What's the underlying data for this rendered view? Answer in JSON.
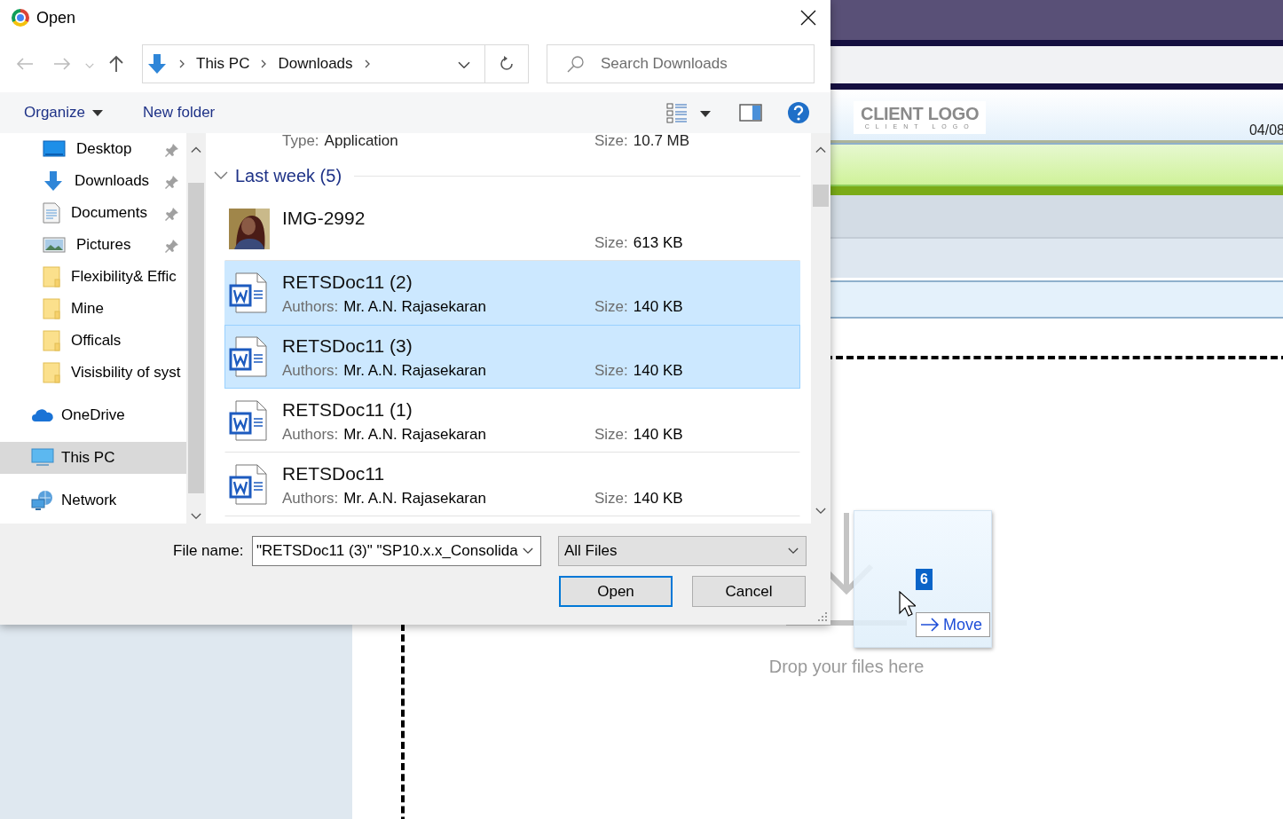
{
  "dialog": {
    "title": "Open",
    "breadcrumb": [
      "This PC",
      "Downloads"
    ],
    "search": {
      "placeholder": "Search Downloads"
    },
    "toolbar": {
      "organize": "Organize",
      "new_folder": "New folder"
    },
    "quick_access": [
      {
        "label": "Desktop",
        "kind": "desktop",
        "pinned": true,
        "selected": false
      },
      {
        "label": "Downloads",
        "kind": "download",
        "pinned": true,
        "selected": false
      },
      {
        "label": "Documents",
        "kind": "documents",
        "pinned": true,
        "selected": false
      },
      {
        "label": "Pictures",
        "kind": "pictures",
        "pinned": true,
        "selected": false
      },
      {
        "label": "Flexibility& Effic",
        "kind": "folder",
        "pinned": false,
        "selected": false
      },
      {
        "label": "Mine",
        "kind": "folder",
        "pinned": false,
        "selected": false
      },
      {
        "label": "Officals",
        "kind": "folder",
        "pinned": false,
        "selected": false
      },
      {
        "label": "Visisbility of syst",
        "kind": "folder",
        "pinned": false,
        "selected": false
      }
    ],
    "locations": [
      {
        "label": "OneDrive",
        "kind": "cloud",
        "selected": false
      },
      {
        "label": "This PC",
        "kind": "pc",
        "selected": true
      },
      {
        "label": "Network",
        "kind": "network",
        "selected": false
      }
    ],
    "partial_item": {
      "type_label": "Type:",
      "type": "Application",
      "size_label": "Size:",
      "size": "10.7 MB"
    },
    "group": {
      "label": "Last week (5)",
      "expanded": true
    },
    "files": [
      {
        "name": "IMG-2992",
        "size_label": "Size:",
        "size": "613 KB",
        "selected": false,
        "focused": false
      },
      {
        "name": "RETSDoc11 (2)",
        "kind": "word",
        "authors_label": "Authors:",
        "authors": "Mr. A.N. Rajasekaran",
        "size_label": "Size:",
        "size": "140 KB",
        "selected": true,
        "focused": false
      },
      {
        "name": "RETSDoc11 (3)",
        "kind": "word",
        "authors_label": "Authors:",
        "authors": "Mr. A.N. Rajasekaran",
        "size_label": "Size:",
        "size": "140 KB",
        "selected": true,
        "focused": true
      },
      {
        "name": "RETSDoc11 (1)",
        "kind": "word",
        "authors_label": "Authors:",
        "authors": "Mr. A.N. Rajasekaran",
        "size_label": "Size:",
        "size": "140 KB",
        "selected": false,
        "focused": false
      },
      {
        "name": "RETSDoc11",
        "kind": "word",
        "authors_label": "Authors:",
        "authors": "Mr. A.N. Rajasekaran",
        "size_label": "Size:",
        "size": "140 KB",
        "selected": false,
        "focused": false
      }
    ],
    "file_name": {
      "label": "File name:",
      "value": "\"RETSDoc11 (3)\" \"SP10.x.x_Consolida"
    },
    "file_type": {
      "value": "All Files"
    },
    "buttons": [
      {
        "label": "Open",
        "kind": "default"
      },
      {
        "label": "Cancel",
        "kind": "normal"
      }
    ]
  },
  "page": {
    "logo": {
      "main": "CLIENT LOGO",
      "sub": "CLIENT LOGO"
    },
    "date": "04/08",
    "drop_zone": {
      "text": "Drop your files here"
    },
    "drag": {
      "count": "6",
      "action": "Move"
    }
  }
}
